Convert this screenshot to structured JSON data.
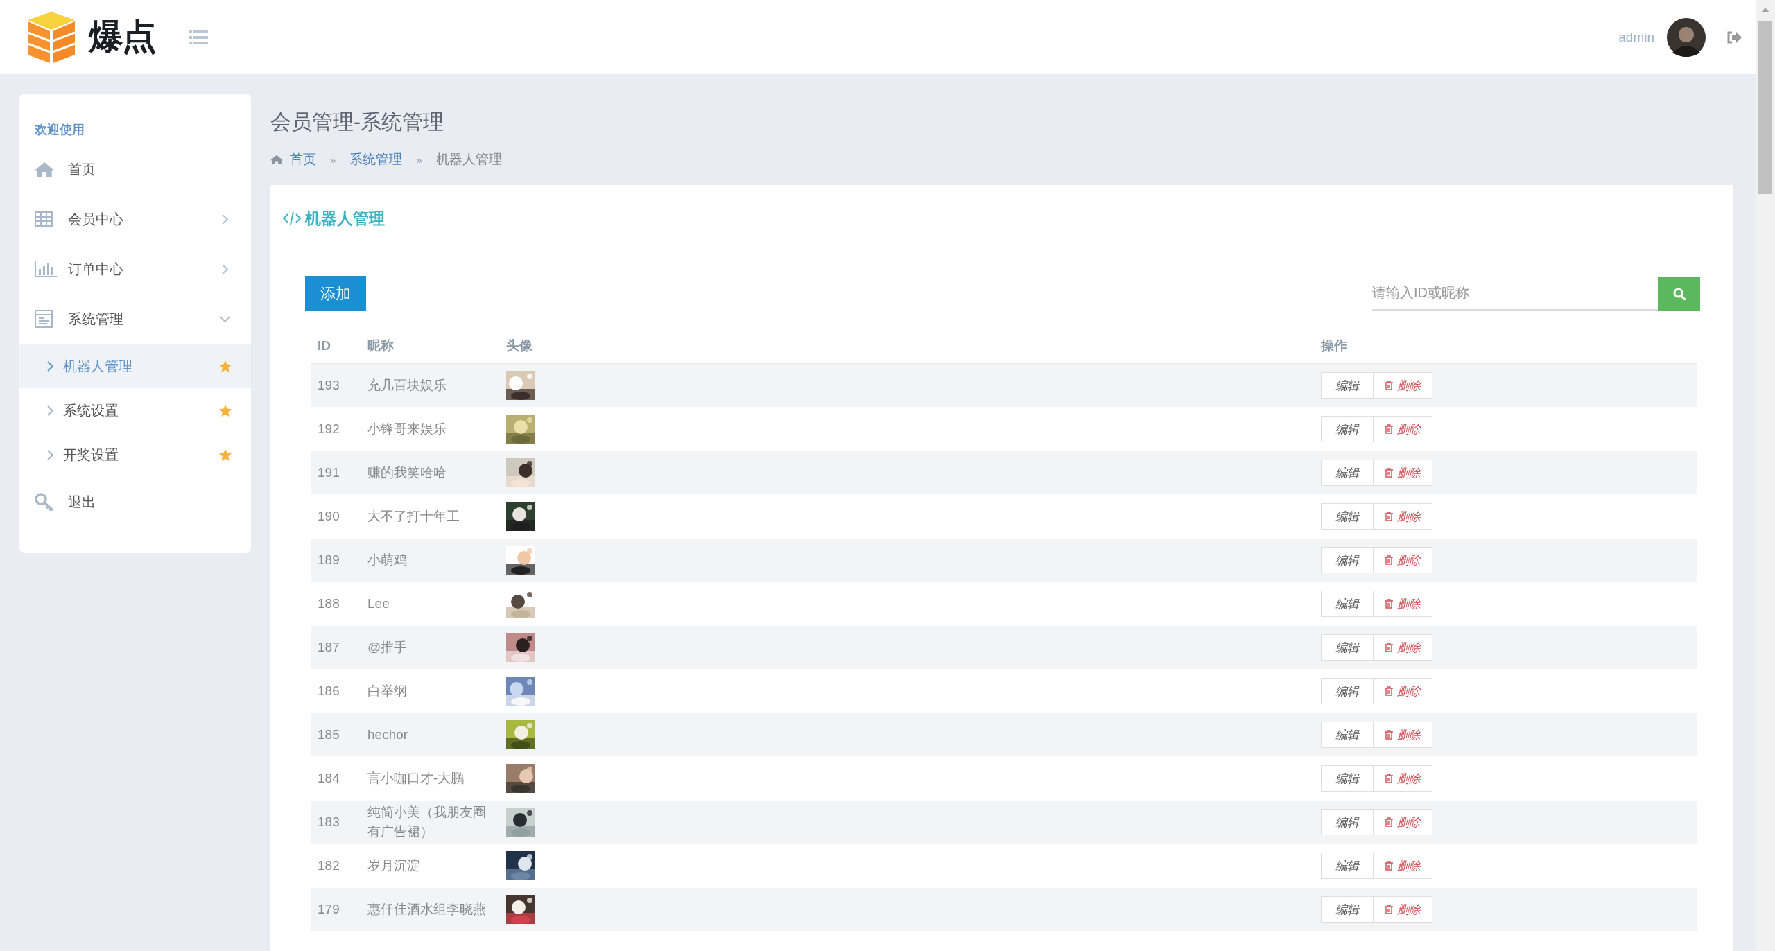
{
  "header": {
    "logo_text": "爆点",
    "user": {
      "name": "admin"
    }
  },
  "sidebar": {
    "heading": "欢迎使用",
    "items": [
      {
        "label": "首页",
        "kind": "link"
      },
      {
        "label": "会员中心",
        "kind": "group",
        "expanded": false
      },
      {
        "label": "订单中心",
        "kind": "group",
        "expanded": false
      },
      {
        "label": "系统管理",
        "kind": "group",
        "expanded": true,
        "children": [
          {
            "label": "机器人管理",
            "selected": true
          },
          {
            "label": "系统设置",
            "selected": false
          },
          {
            "label": "开奖设置",
            "selected": false
          }
        ]
      },
      {
        "label": "退出",
        "kind": "link"
      }
    ]
  },
  "page": {
    "title": "会员管理-系统管理",
    "breadcrumb": [
      {
        "label": "首页",
        "kind": "link"
      },
      {
        "label": "系统管理",
        "kind": "link",
        "separator": "»"
      },
      {
        "label": "机器人管理",
        "kind": "current",
        "separator": "»"
      }
    ]
  },
  "card": {
    "title": "机器人管理",
    "add_button": "添加",
    "search": {
      "placeholder": "请输入ID或昵称"
    },
    "table": {
      "columns": [
        "ID",
        "昵称",
        "头像",
        "操作"
      ],
      "rows": [
        {
          "id": "193",
          "nickname": "充几百块娱乐",
          "avatar": {
            "kind": "picture"
          },
          "actions": [
            "编辑",
            "删除"
          ]
        },
        {
          "id": "192",
          "nickname": "小锋哥来娱乐",
          "avatar": {
            "kind": "picture"
          },
          "actions": [
            "编辑",
            "删除"
          ]
        },
        {
          "id": "191",
          "nickname": "赚的我笑哈哈",
          "avatar": {
            "kind": "picture"
          },
          "actions": [
            "编辑",
            "删除"
          ]
        },
        {
          "id": "190",
          "nickname": "大不了打十年工",
          "avatar": {
            "kind": "picture"
          },
          "actions": [
            "编辑",
            "删除"
          ]
        },
        {
          "id": "189",
          "nickname": "小萌鸡",
          "avatar": {
            "kind": "picture"
          },
          "actions": [
            "编辑",
            "删除"
          ]
        },
        {
          "id": "188",
          "nickname": "Lee",
          "avatar": {
            "kind": "picture"
          },
          "actions": [
            "编辑",
            "删除"
          ]
        },
        {
          "id": "187",
          "nickname": "@推手",
          "avatar": {
            "kind": "picture"
          },
          "actions": [
            "编辑",
            "删除"
          ]
        },
        {
          "id": "186",
          "nickname": "白举纲",
          "avatar": {
            "kind": "picture"
          },
          "actions": [
            "编辑",
            "删除"
          ]
        },
        {
          "id": "185",
          "nickname": "hechor",
          "avatar": {
            "kind": "picture"
          },
          "actions": [
            "编辑",
            "删除"
          ]
        },
        {
          "id": "184",
          "nickname": "言小咖口才-大鹏",
          "avatar": {
            "kind": "picture"
          },
          "actions": [
            "编辑",
            "删除"
          ]
        },
        {
          "id": "183",
          "nickname": "纯简小美（我朋友圈有广告裙）",
          "avatar": {
            "kind": "picture"
          },
          "actions": [
            "编辑",
            "删除"
          ]
        },
        {
          "id": "182",
          "nickname": "岁月沉淀",
          "avatar": {
            "kind": "picture"
          },
          "actions": [
            "编辑",
            "删除"
          ]
        },
        {
          "id": "179",
          "nickname": "惠仟佳酒水组李晓燕",
          "avatar": {
            "kind": "picture"
          },
          "actions": [
            "编辑",
            "删除"
          ]
        }
      ]
    }
  }
}
